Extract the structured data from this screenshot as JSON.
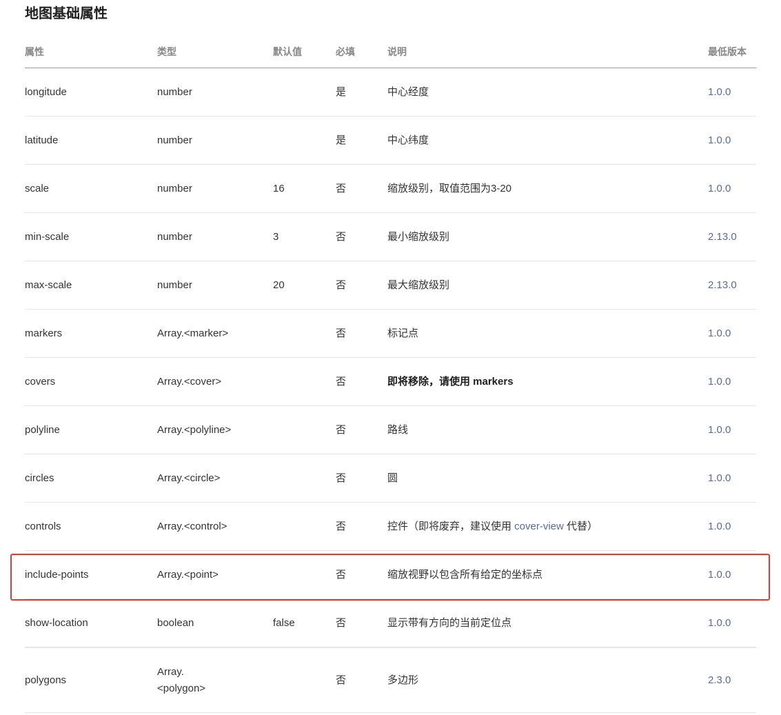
{
  "section": {
    "title": "地图基础属性"
  },
  "table": {
    "headers": {
      "attr": "属性",
      "type": "类型",
      "default": "默认值",
      "required": "必填",
      "desc": "说明",
      "version": "最低版本"
    },
    "rows": [
      {
        "attr": "longitude",
        "type": "number",
        "default": "",
        "required": "是",
        "desc": "中心经度",
        "version": "1.0.0"
      },
      {
        "attr": "latitude",
        "type": "number",
        "default": "",
        "required": "是",
        "desc": "中心纬度",
        "version": "1.0.0"
      },
      {
        "attr": "scale",
        "type": "number",
        "default": "16",
        "required": "否",
        "desc": "缩放级别，取值范围为3-20",
        "version": "1.0.0"
      },
      {
        "attr": "min-scale",
        "type": "number",
        "default": "3",
        "required": "否",
        "desc": "最小缩放级别",
        "version": "2.13.0"
      },
      {
        "attr": "max-scale",
        "type": "number",
        "default": "20",
        "required": "否",
        "desc": "最大缩放级别",
        "version": "2.13.0"
      },
      {
        "attr": "markers",
        "type": "Array.<marker>",
        "default": "",
        "required": "否",
        "desc": "标记点",
        "version": "1.0.0"
      },
      {
        "attr": "covers",
        "type": "Array.<cover>",
        "default": "",
        "required": "否",
        "desc_bold": "即将移除，请使用 markers",
        "version": "1.0.0"
      },
      {
        "attr": "polyline",
        "type": "Array.<polyline>",
        "default": "",
        "required": "否",
        "desc": "路线",
        "version": "1.0.0"
      },
      {
        "attr": "circles",
        "type": "Array.<circle>",
        "default": "",
        "required": "否",
        "desc": "圆",
        "version": "1.0.0"
      },
      {
        "attr": "controls",
        "type": "Array.<control>",
        "default": "",
        "required": "否",
        "desc_prefix": "控件（即将废弃，建议使用 ",
        "desc_link": "cover-view",
        "desc_suffix": " 代替）",
        "version": "1.0.0"
      },
      {
        "attr": "include-points",
        "type": "Array.<point>",
        "default": "",
        "required": "否",
        "desc": "缩放视野以包含所有给定的坐标点",
        "version": "1.0.0",
        "highlighted": true
      },
      {
        "attr": "show-location",
        "type": "boolean",
        "default": "false",
        "required": "否",
        "desc": "显示带有方向的当前定位点",
        "version": "1.0.0"
      },
      {
        "attr": "polygons",
        "type_line1": "Array.",
        "type_line2": "<polygon>",
        "default": "",
        "required": "否",
        "desc": "多边形",
        "version": "2.3.0"
      }
    ]
  },
  "colors": {
    "link": "#576b95",
    "highlight_border": "#e23a3a"
  }
}
